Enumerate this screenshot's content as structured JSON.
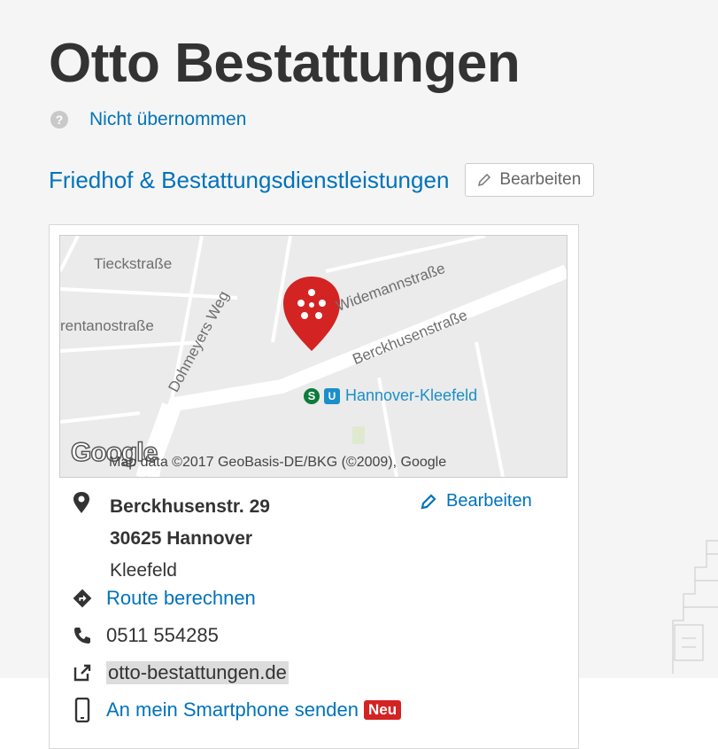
{
  "business": {
    "name": "Otto Bestattungen",
    "claim_status": "Nicht übernommen",
    "category": "Friedhof & Bestattungsdienstleistungen",
    "edit_button_label": "Bearbeiten"
  },
  "map": {
    "street_labels": [
      "Tieckstraße",
      "Dohmeyers Weg",
      "Widemannstraße",
      "Berckhusenstraße",
      "rentanostraße"
    ],
    "station": {
      "s_badge": "S",
      "u_badge": "U",
      "name": "Hannover-Kleefeld"
    },
    "logo_text": "Google",
    "copyright": "Map data ©2017 GeoBasis-DE/BKG (©2009), Google"
  },
  "address": {
    "street": "Berckhusenstr. 29",
    "city": "30625 Hannover",
    "neighborhood": "Kleefeld",
    "edit_label": "Bearbeiten"
  },
  "actions": {
    "route_label": "Route berechnen",
    "phone": "0511 554285",
    "website": "otto-bestattungen.de",
    "send_to_phone_label": "An mein Smartphone senden",
    "new_badge": "Neu"
  },
  "icons": {
    "claim": "info-circle-icon",
    "edit": "pencil-icon",
    "map_pin": "yelp-map-marker-icon",
    "address": "location-pin-icon",
    "route": "directions-icon",
    "phone": "phone-icon",
    "website": "external-link-icon",
    "send": "smartphone-icon"
  },
  "colors": {
    "link": "#0073bb",
    "brand_red": "#d32323",
    "text": "#333333"
  }
}
